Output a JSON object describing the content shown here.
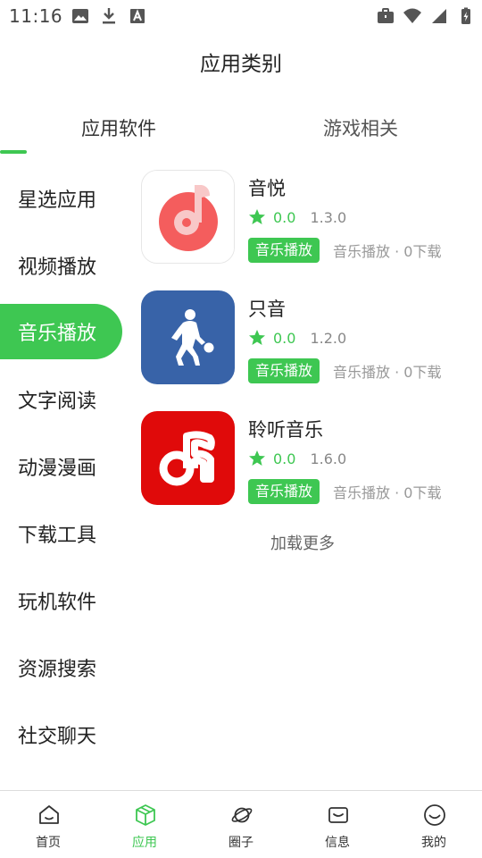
{
  "status_bar": {
    "time": "11:16"
  },
  "header": {
    "title": "应用类别"
  },
  "top_tabs": [
    {
      "label": "应用软件",
      "active": true
    },
    {
      "label": "游戏相关",
      "active": false
    }
  ],
  "sidebar": {
    "items": [
      {
        "label": "星选应用"
      },
      {
        "label": "视频播放"
      },
      {
        "label": "音乐播放",
        "active": true
      },
      {
        "label": "文字阅读"
      },
      {
        "label": "动漫漫画"
      },
      {
        "label": "下载工具"
      },
      {
        "label": "玩机软件"
      },
      {
        "label": "资源搜索"
      },
      {
        "label": "社交聊天"
      }
    ]
  },
  "apps": [
    {
      "name": "音悦",
      "rating": "0.0",
      "version": "1.3.0",
      "category": "音乐播放",
      "meta": "音乐播放 · 0下载",
      "icon": "music-note-circle-icon"
    },
    {
      "name": "只音",
      "rating": "0.0",
      "version": "1.2.0",
      "category": "音乐播放",
      "meta": "音乐播放 · 0下载",
      "icon": "basketball-player-icon"
    },
    {
      "name": "聆听音乐",
      "rating": "0.0",
      "version": "1.6.0",
      "category": "音乐播放",
      "meta": "音乐播放 · 0下载",
      "icon": "music-note-red-icon"
    }
  ],
  "load_more": "加载更多",
  "bottom_nav": [
    {
      "label": "首页",
      "icon": "home-icon"
    },
    {
      "label": "应用",
      "icon": "cube-icon",
      "active": true
    },
    {
      "label": "圈子",
      "icon": "planet-icon"
    },
    {
      "label": "信息",
      "icon": "message-icon"
    },
    {
      "label": "我的",
      "icon": "smile-icon"
    }
  ],
  "colors": {
    "accent": "#3ec752",
    "icon1_bg": "#f45d5d",
    "icon2_bg": "#3863a8",
    "icon3_bg": "#e00a0a"
  }
}
